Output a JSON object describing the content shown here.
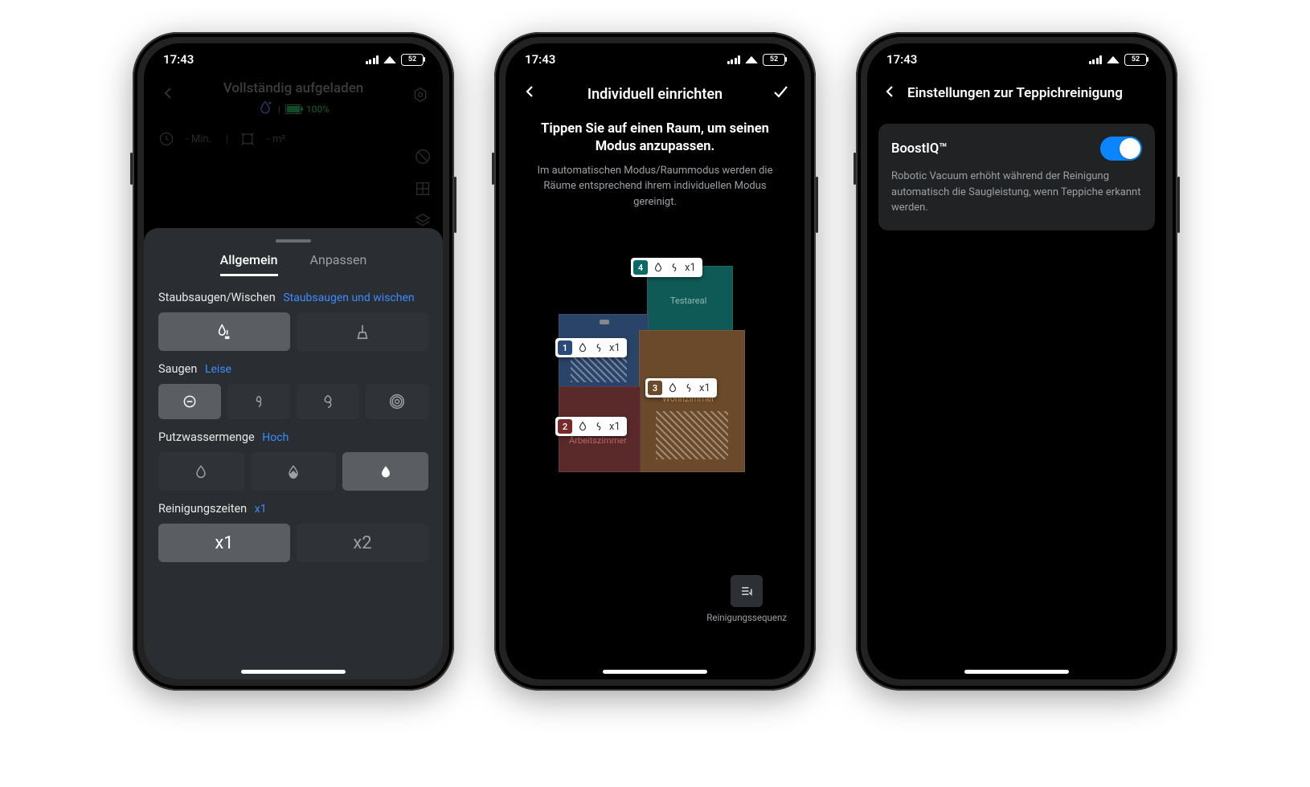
{
  "status": {
    "time": "17:43",
    "battery": "52"
  },
  "phone1": {
    "header_title": "Vollständig aufgeladen",
    "battery_pct": "100%",
    "info_min": "- Min.",
    "info_area": "- m²",
    "tabs": {
      "general": "Allgemein",
      "customize": "Anpassen",
      "active": "general"
    },
    "mode": {
      "label": "Staubsaugen/Wischen",
      "value": "Staubsaugen und wischen",
      "selected": 0
    },
    "suction": {
      "label": "Saugen",
      "value": "Leise",
      "selected": 0
    },
    "water": {
      "label": "Putzwassermenge",
      "value": "Hoch",
      "selected": 2
    },
    "passes": {
      "label": "Reinigungszeiten",
      "value": "x1",
      "options": [
        "x1",
        "x2"
      ],
      "selected": 0
    }
  },
  "phone2": {
    "title": "Individuell einrichten",
    "headline": "Tippen Sie auf einen Raum, um seinen Modus anzupassen.",
    "sub": "Im automatischen Modus/Raummodus werden die Räume entsprechend ihrem individuellen Modus gereinigt.",
    "rooms": [
      {
        "n": "4",
        "name": "Testareal",
        "mult": "x1"
      },
      {
        "n": "1",
        "name": "",
        "mult": "x1"
      },
      {
        "n": "3",
        "name": "Wohnzimmer",
        "mult": "x1"
      },
      {
        "n": "2",
        "name": "Arbeitszimmer",
        "mult": "x1"
      }
    ],
    "sequence_label": "Reinigungssequenz"
  },
  "phone3": {
    "title": "Einstellungen zur Teppichreinigung",
    "card_title": "BoostIQ™",
    "card_desc": "Robotic Vacuum erhöht während der Reinigung automatisch die Saugleistung, wenn Teppiche erkannt werden.",
    "toggle_on": true
  }
}
